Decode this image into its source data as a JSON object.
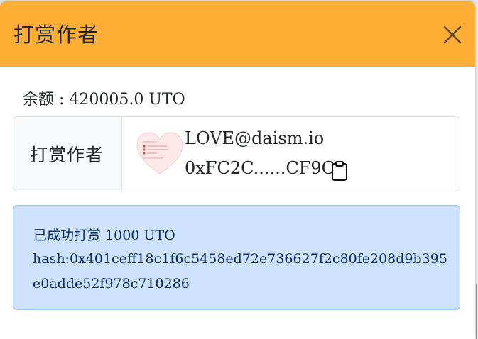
{
  "modal": {
    "title": "打赏作者",
    "close_icon": "close-x-icon"
  },
  "balance": {
    "label": "余额 : 420005.0 UTO"
  },
  "recipient": {
    "label": "打赏作者",
    "account_name": "LOVE@daism.io",
    "address": "0xFC2C......CF9C",
    "avatar_icon": "heart-avatar-icon",
    "copy_icon": "clipboard-copy-icon"
  },
  "alert": {
    "message": "已成功打赏 1000 UTO",
    "hash": "hash:0x401ceff18c1f6c5458ed72e736627f2c80fe208d9b395e0adde52f978c710286"
  },
  "colors": {
    "header": "#ffae35",
    "alert_bg": "#cfe2ff",
    "alert_border": "#9ec5fe",
    "alert_text": "#052c65"
  }
}
